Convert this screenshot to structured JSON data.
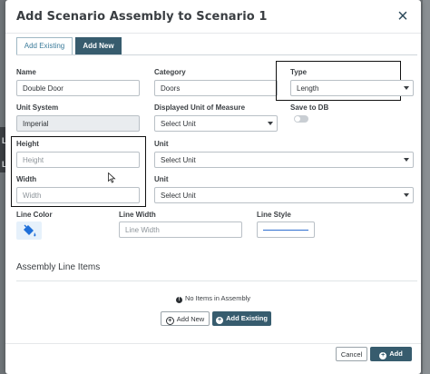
{
  "backdrop": {
    "items": [
      "LI",
      "LI"
    ]
  },
  "modal": {
    "title": "Add Scenario Assembly to Scenario 1",
    "close_glyph": "×"
  },
  "tabs": [
    {
      "label": "Add Existing",
      "active": true
    },
    {
      "label": "Add New",
      "active": false
    }
  ],
  "form": {
    "name": {
      "label": "Name",
      "value": "Double Door"
    },
    "category": {
      "label": "Category",
      "value": "Doors"
    },
    "type": {
      "label": "Type",
      "value": "Length"
    },
    "unit_system": {
      "label": "Unit System",
      "value": "Imperial"
    },
    "displayed_unit": {
      "label": "Displayed Unit of Measure",
      "value": "Select Unit"
    },
    "save_to_db": {
      "label": "Save to DB",
      "checked": false
    },
    "height": {
      "label": "Height",
      "placeholder": "Height"
    },
    "height_unit": {
      "label": "Unit",
      "value": "Select Unit"
    },
    "width": {
      "label": "Width",
      "placeholder": "Width"
    },
    "width_unit": {
      "label": "Unit",
      "value": "Select Unit"
    },
    "line_color": {
      "label": "Line Color",
      "color": "#1e6fd9"
    },
    "line_width": {
      "label": "Line Width",
      "placeholder": "Line Width"
    },
    "line_style": {
      "label": "Line Style",
      "color": "#2f6fd1"
    }
  },
  "assembly_items": {
    "title": "Assembly Line Items",
    "empty_message": "No Items in Assembly",
    "add_new_label": "Add New",
    "add_existing_label": "Add Existing"
  },
  "footer": {
    "cancel_label": "Cancel",
    "add_label": "Add"
  },
  "colors": {
    "accent": "#375c6e",
    "tab_active_text": "#3b7b9a"
  }
}
